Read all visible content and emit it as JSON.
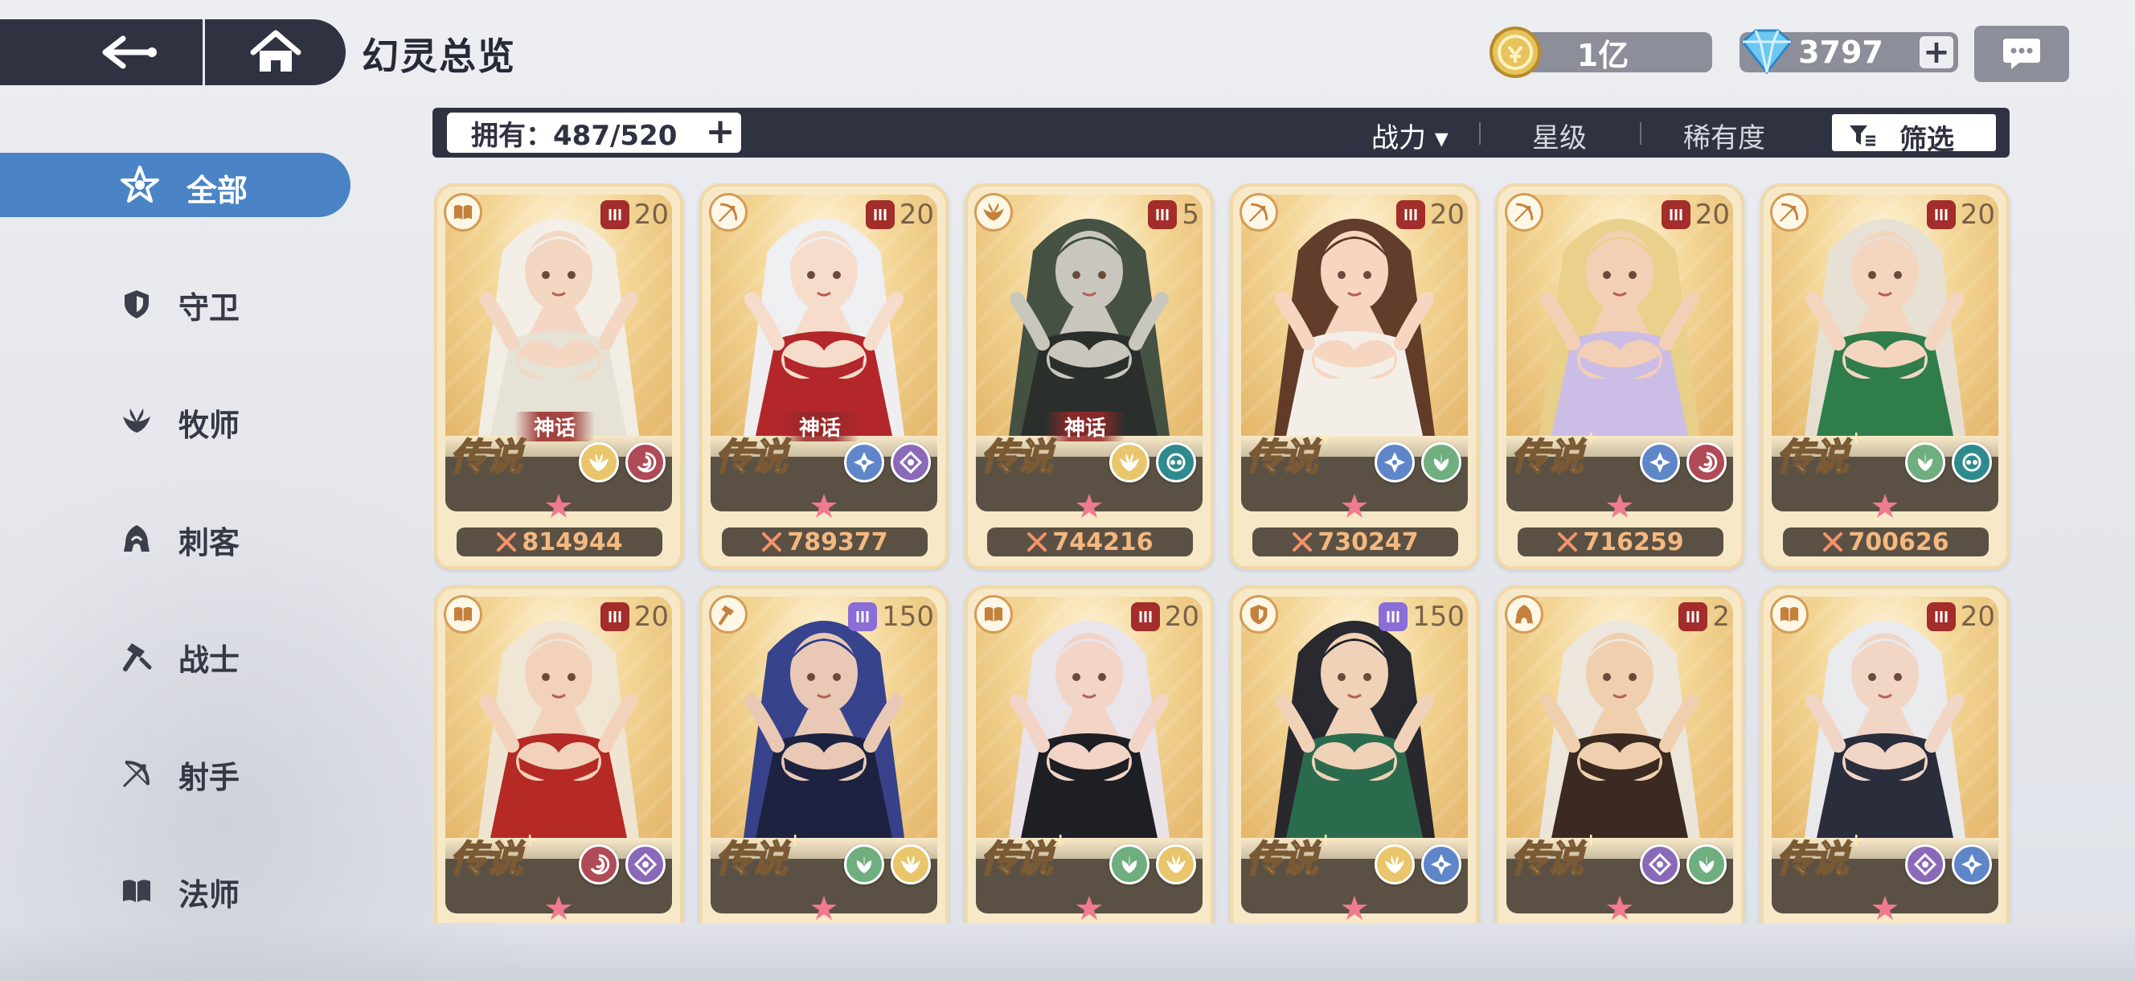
{
  "header": {
    "title": "幻灵总览",
    "gold": "1亿",
    "gems": "3797",
    "plus": "+"
  },
  "sidebar": {
    "items": [
      {
        "label": "全部",
        "icon": "star-emblem-icon"
      },
      {
        "label": "守卫",
        "icon": "shield-icon"
      },
      {
        "label": "牧师",
        "icon": "wing-icon"
      },
      {
        "label": "刺客",
        "icon": "hood-icon"
      },
      {
        "label": "战士",
        "icon": "hammer-icon"
      },
      {
        "label": "射手",
        "icon": "bow-icon"
      },
      {
        "label": "法师",
        "icon": "book-icon"
      }
    ]
  },
  "toolbar": {
    "owned": "拥有：487/520",
    "plus": "+",
    "sort_power": "战力 ▾",
    "sort_star": "星级",
    "sort_rarity": "稀有度",
    "filter": "筛选"
  },
  "cards": [
    {
      "class_icon": "book-icon",
      "level": "20",
      "tag": "red",
      "rarity": "传说",
      "plus": "",
      "mythic": "神话",
      "e1": "el-gold",
      "e2": "el-fire",
      "power": "814944",
      "hair": "#f2efe9",
      "skin": "#f3d7c2",
      "outfit": "#e7e2d6"
    },
    {
      "class_icon": "bow-icon",
      "level": "20",
      "tag": "red",
      "rarity": "传说",
      "plus": "",
      "mythic": "神话",
      "e1": "el-ice",
      "e2": "el-dark",
      "power": "789377",
      "hair": "#eef0f5",
      "skin": "#f6dccb",
      "outfit": "#b3272b"
    },
    {
      "class_icon": "wing-icon",
      "level": "5",
      "tag": "red",
      "rarity": "传说",
      "plus": "",
      "mythic": "神话",
      "e1": "el-gold",
      "e2": "el-teal",
      "power": "744216",
      "hair": "#3b4a3d",
      "skin": "#c9c7bd",
      "outfit": "#2b2f2c"
    },
    {
      "class_icon": "bow-icon",
      "level": "20",
      "tag": "red",
      "rarity": "传说",
      "plus": "+",
      "mythic": "",
      "e1": "el-ice",
      "e2": "el-green",
      "power": "730247",
      "hair": "#5b3424",
      "skin": "#f6d6c0",
      "outfit": "#f3efe8"
    },
    {
      "class_icon": "bow-icon",
      "level": "20",
      "tag": "red",
      "rarity": "传说",
      "plus": "+",
      "mythic": "",
      "e1": "el-ice",
      "e2": "el-fire",
      "power": "716259",
      "hair": "#e8d08a",
      "skin": "#f3d0b5",
      "outfit": "#cbbde6"
    },
    {
      "class_icon": "bow-icon",
      "level": "20",
      "tag": "red",
      "rarity": "传说",
      "plus": "+",
      "mythic": "",
      "e1": "el-green",
      "e2": "el-teal",
      "power": "700626",
      "hair": "#e6e0d6",
      "skin": "#f4d5c0",
      "outfit": "#2f7d4a"
    },
    {
      "class_icon": "book-icon",
      "level": "20",
      "tag": "red",
      "rarity": "传说",
      "plus": "+",
      "mythic": "",
      "e1": "el-fire",
      "e2": "el-dark",
      "power": "",
      "hair": "#efe6d6",
      "skin": "#f3d2bb",
      "outfit": "#b52a24"
    },
    {
      "class_icon": "hammer-icon",
      "level": "150",
      "tag": "purple",
      "rarity": "传说",
      "plus": "+",
      "mythic": "",
      "e1": "el-green",
      "e2": "el-gold",
      "power": "",
      "hair": "#2c3a8a",
      "skin": "#e9c9b5",
      "outfit": "#1d2240"
    },
    {
      "class_icon": "book-icon",
      "level": "20",
      "tag": "red",
      "rarity": "传说",
      "plus": "+",
      "mythic": "",
      "e1": "el-green",
      "e2": "el-gold",
      "power": "",
      "hair": "#e9e4ee",
      "skin": "#f2d5c6",
      "outfit": "#1e1e25"
    },
    {
      "class_icon": "shield-icon",
      "level": "150",
      "tag": "purple",
      "rarity": "传说",
      "plus": "+",
      "mythic": "",
      "e1": "el-gold",
      "e2": "el-ice",
      "power": "",
      "hair": "#1d1f28",
      "skin": "#f0d2b8",
      "outfit": "#2a6b4e"
    },
    {
      "class_icon": "hood-icon",
      "level": "2",
      "tag": "red",
      "rarity": "传说",
      "plus": "+",
      "mythic": "",
      "e1": "el-dark",
      "e2": "el-green",
      "power": "",
      "hair": "#ece7df",
      "skin": "#f0cfae",
      "outfit": "#3a2a22"
    },
    {
      "class_icon": "book-icon",
      "level": "20",
      "tag": "red",
      "rarity": "传说",
      "plus": "+",
      "mythic": "",
      "e1": "el-dark",
      "e2": "el-ice",
      "power": "",
      "hair": "#e9ebf0",
      "skin": "#f1d6c6",
      "outfit": "#2a2d3c"
    }
  ]
}
